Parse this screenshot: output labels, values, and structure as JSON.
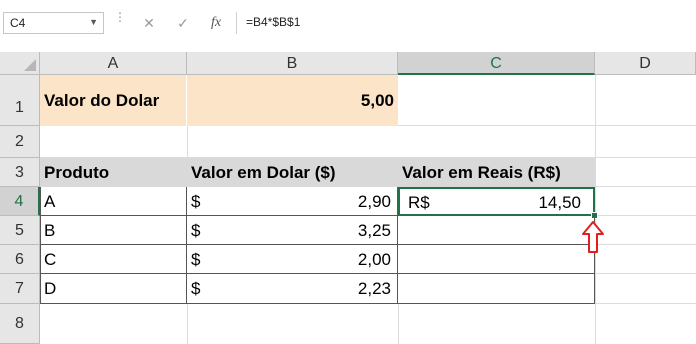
{
  "formula_bar": {
    "name_box": "C4",
    "cancel_icon": "✕",
    "enter_icon": "✓",
    "function_icon": "fx",
    "formula": "=B4*$B$1"
  },
  "columns": [
    "A",
    "B",
    "C",
    "D"
  ],
  "rows": [
    "1",
    "2",
    "3",
    "4",
    "5",
    "6",
    "7",
    "8"
  ],
  "cells": {
    "A1": "Valor do Dolar",
    "B1": "5,00",
    "A3": "Produto",
    "B3": "Valor em Dolar ($)",
    "C3": "Valor em Reais (R$)",
    "A4": "A",
    "B4_sym": "$",
    "B4": "2,90",
    "C4_sym": "R$",
    "C4": "14,50",
    "A5": "B",
    "B5_sym": "$",
    "B5": "3,25",
    "A6": "C",
    "B6_sym": "$",
    "B6": "2,00",
    "A7": "D",
    "B7_sym": "$",
    "B7": "2,23"
  },
  "active_cell": "C4",
  "colors": {
    "accent": "#217346",
    "header_bg": "#e6e6e6",
    "highlight": "#fce4c8",
    "table_header": "#d9d9d9",
    "annotation_arrow": "#e02020"
  },
  "annotation": {
    "icon": "up-arrow-icon"
  }
}
